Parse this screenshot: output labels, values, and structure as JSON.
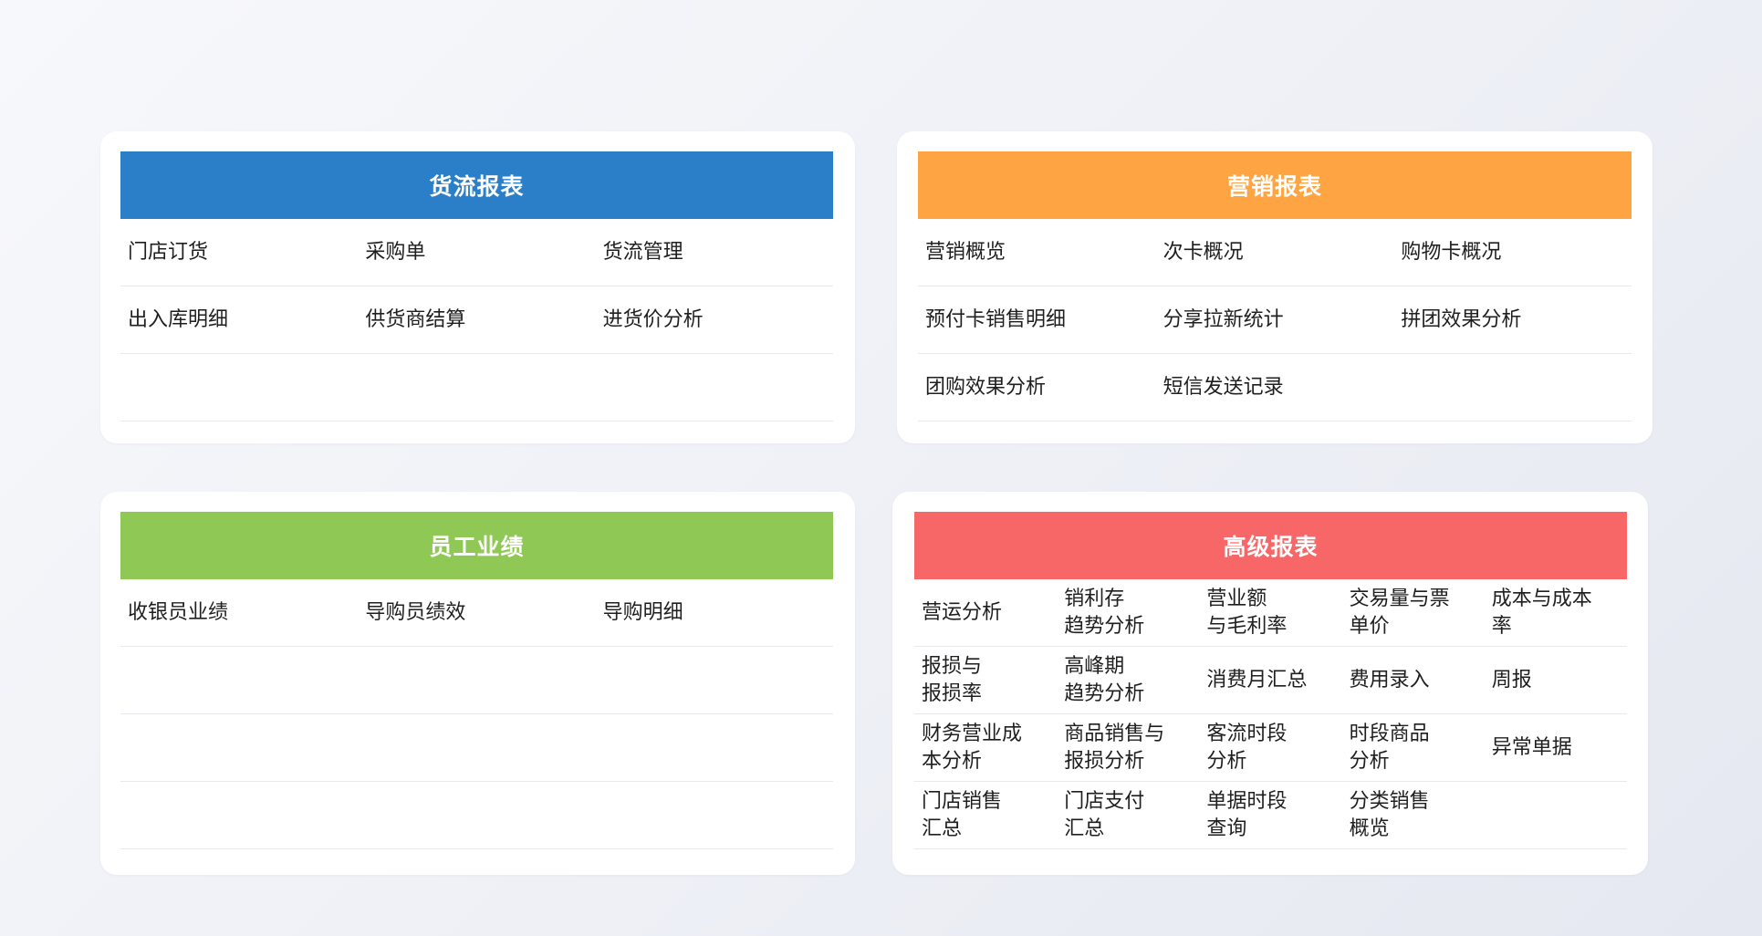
{
  "cards": {
    "goods": {
      "title": "货流报表",
      "color": "#2a7fc8",
      "rows": [
        [
          "门店订货",
          "采购单",
          "货流管理"
        ],
        [
          "出入库明细",
          "供货商结算",
          "进货价分析"
        ],
        [
          "",
          "",
          ""
        ]
      ]
    },
    "marketing": {
      "title": "营销报表",
      "color": "#ffa443",
      "rows": [
        [
          "营销概览",
          "次卡概况",
          "购物卡概况"
        ],
        [
          "预付卡销售明细",
          "分享拉新统计",
          "拼团效果分析"
        ],
        [
          "团购效果分析",
          "短信发送记录",
          ""
        ]
      ]
    },
    "staff": {
      "title": "员工业绩",
      "color": "#8fc855",
      "rows": [
        [
          "收银员业绩",
          "导购员绩效",
          "导购明细"
        ],
        [
          "",
          "",
          ""
        ],
        [
          "",
          "",
          ""
        ],
        [
          "",
          "",
          ""
        ]
      ]
    },
    "advanced": {
      "title": "高级报表",
      "color": "#f86767",
      "rows": [
        [
          "营运分析",
          "销利存\n趋势分析",
          "营业额\n与毛利率",
          "交易量与票\n单价",
          "成本与成本\n率"
        ],
        [
          "报损与\n报损率",
          "高峰期\n趋势分析",
          "消费月汇总",
          "费用录入",
          "周报"
        ],
        [
          "财务营业成\n本分析",
          "商品销售与\n报损分析",
          "客流时段\n分析",
          "时段商品\n分析",
          "异常单据"
        ],
        [
          "门店销售\n汇总",
          "门店支付\n汇总",
          "单据时段\n查询",
          "分类销售\n概览",
          ""
        ]
      ]
    }
  }
}
